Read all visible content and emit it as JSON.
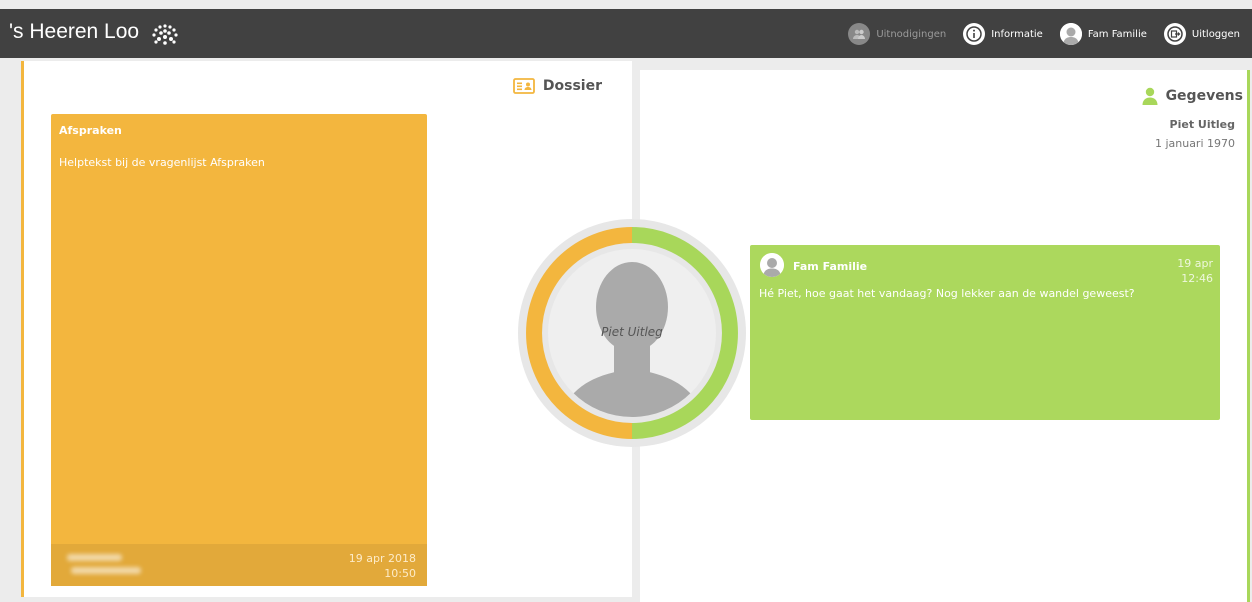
{
  "header": {
    "logo_text": "'s Heeren Loo",
    "nav": [
      {
        "label": "Uitnodigingen",
        "icon": "group-icon"
      },
      {
        "label": "Informatie",
        "icon": "info-icon"
      },
      {
        "label": "Fam Familie",
        "icon": "user-avatar-icon"
      },
      {
        "label": "Uitloggen",
        "icon": "logout-icon"
      }
    ]
  },
  "left_panel": {
    "title": "Dossier",
    "card": {
      "title": "Afspraken",
      "text": "Helptekst bij de vragenlijst Afspraken",
      "date": "19 apr 2018",
      "time": "10:50"
    }
  },
  "right_panel": {
    "title": "Gegevens",
    "person_name": "Piet Uitleg",
    "person_dob": "1 januari 1970",
    "message": {
      "author": "Fam Familie",
      "date": "19 apr",
      "time": "12:46",
      "text": "Hé Piet, hoe gaat het vandaag? Nog lekker aan de wandel geweest?"
    }
  },
  "center": {
    "name": "Piet Uitleg"
  },
  "colors": {
    "accent_yellow": "#f3b63e",
    "accent_green": "#a8d75a",
    "topbar": "#414141"
  }
}
